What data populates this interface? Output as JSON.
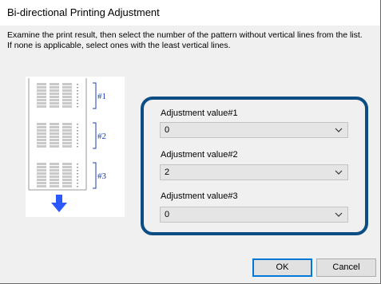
{
  "dialog": {
    "title": "Bi-directional Printing Adjustment",
    "instruction_line1": "Examine the print result, then select the number of the pattern without vertical lines from the list.",
    "instruction_line2": "If none is applicable, select ones with the least vertical lines."
  },
  "illustration": {
    "labels": [
      "#1",
      "#2",
      "#3"
    ],
    "arrow_color": "#2b59ff"
  },
  "adjustments": [
    {
      "label": "Adjustment value#1",
      "value": "0"
    },
    {
      "label": "Adjustment value#2",
      "value": "2"
    },
    {
      "label": "Adjustment value#3",
      "value": "0"
    }
  ],
  "buttons": {
    "ok": "OK",
    "cancel": "Cancel"
  },
  "colors": {
    "highlight_border": "#0d4d84",
    "focus_border": "#0078d7"
  }
}
